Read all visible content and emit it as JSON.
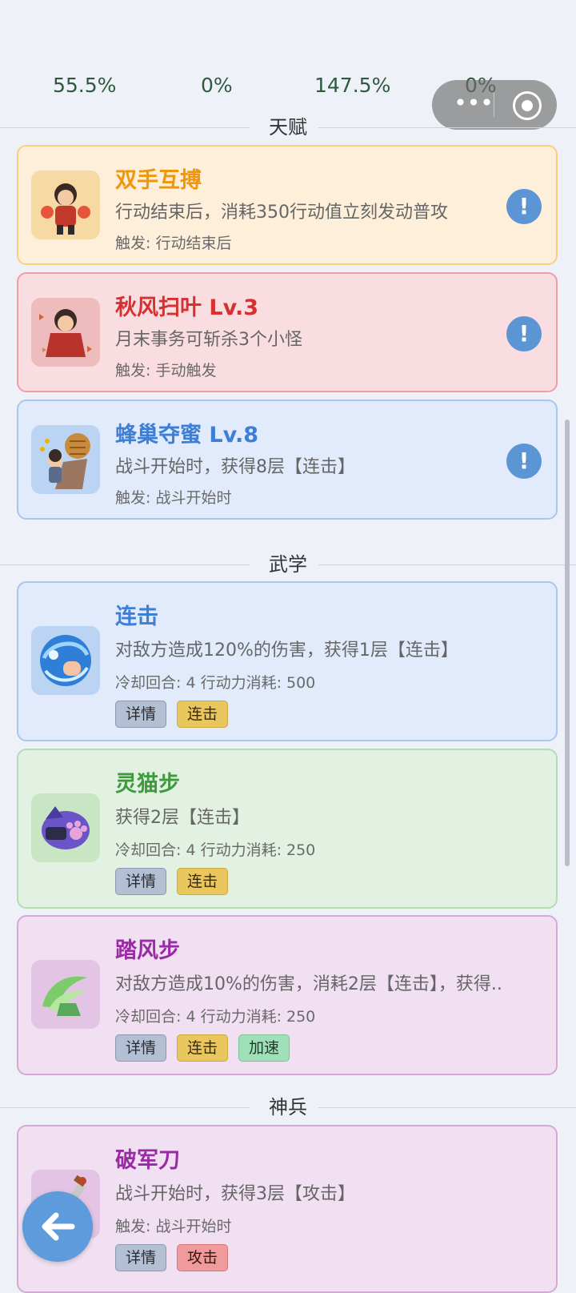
{
  "stats": [
    "55.5%",
    "0%",
    "147.5%",
    "0%"
  ],
  "capsule": {
    "menu_icon": "more-dots-icon",
    "close_icon": "target-icon"
  },
  "sections": {
    "talent": "天赋",
    "martial": "武学",
    "weapon": "神兵"
  },
  "talents": [
    {
      "title": "双手互搏",
      "desc": "行动结束后，消耗350行动值立刻发动普攻",
      "trigger": "触发: 行动结束后",
      "color": "#f0960c",
      "icon": "dual-hands-avatar-icon"
    },
    {
      "title": "秋风扫叶  Lv.3",
      "desc": "月末事务可斩杀3个小怪",
      "trigger": "触发: 手动触发",
      "color": "#d8302f",
      "icon": "autumn-wind-avatar-icon"
    },
    {
      "title": "蜂巢夺蜜  Lv.8",
      "desc": "战斗开始时，获得8层【连击】",
      "trigger": "触发: 战斗开始时",
      "color": "#3d7fd6",
      "icon": "beehive-avatar-icon"
    }
  ],
  "skills": [
    {
      "title": "连击",
      "desc": "对敌方造成120%的伤害，获得1层【连击】",
      "meta": "冷却回合: 4  行动力消耗: 500",
      "tags": [
        "详情",
        "连击"
      ],
      "color": "#3d7fd6",
      "icon": "fist-water-icon"
    },
    {
      "title": "灵猫步",
      "desc": "获得2层【连击】",
      "meta": "冷却回合: 4  行动力消耗: 250",
      "tags": [
        "详情",
        "连击"
      ],
      "color": "#3f9a3c",
      "icon": "cat-paw-icon"
    },
    {
      "title": "踏风步",
      "desc": "对敌方造成10%的伤害，消耗2层【连击】，获得..",
      "meta": "冷却回合: 4  行动力消耗: 250",
      "tags": [
        "详情",
        "连击",
        "加速"
      ],
      "color": "#9b2aa6",
      "icon": "wind-boot-icon"
    }
  ],
  "weapon": {
    "title": "破军刀",
    "desc": "战斗开始时，获得3层【攻击】",
    "trigger": "触发: 战斗开始时",
    "tags": [
      "详情",
      "攻击"
    ],
    "color": "#9b2aa6",
    "icon": "blade-icon"
  },
  "info_symbol": "!",
  "back_icon": "arrow-left-icon"
}
